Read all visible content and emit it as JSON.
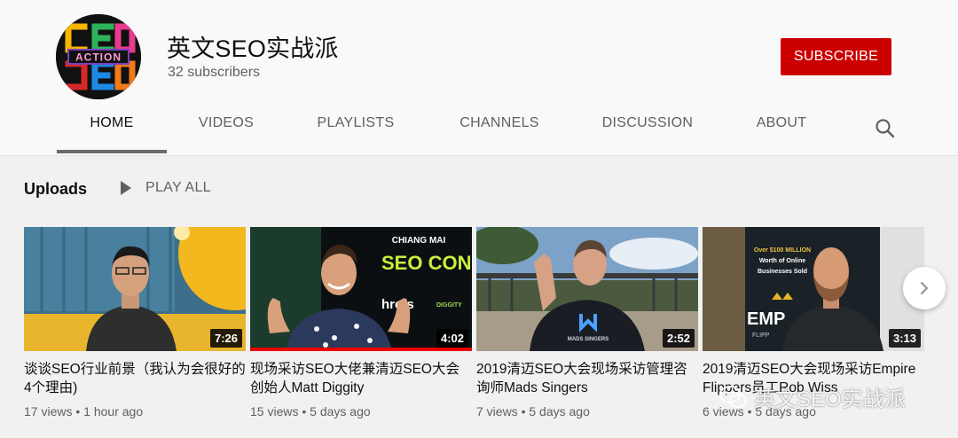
{
  "channel": {
    "name": "英文SEO实战派",
    "subscribers": "32 subscribers",
    "subscribe_label": "SUBSCRIBE",
    "avatar_text": "ACTION"
  },
  "tabs": [
    {
      "label": "HOME",
      "active": true
    },
    {
      "label": "VIDEOS"
    },
    {
      "label": "PLAYLISTS"
    },
    {
      "label": "CHANNELS"
    },
    {
      "label": "DISCUSSION"
    },
    {
      "label": "ABOUT"
    }
  ],
  "uploads": {
    "title": "Uploads",
    "play_all": "PLAY ALL"
  },
  "videos": [
    {
      "title": "谈谈SEO行业前景（我认为会很好的4个理由)",
      "duration": "7:26",
      "views": "17 views",
      "age": "1 hour ago"
    },
    {
      "title": "现场采访SEO大佬兼清迈SEO大会创始人Matt Diggity",
      "duration": "4:02",
      "views": "15 views",
      "age": "5 days ago",
      "thumb_text_1": "CHIANG MAI",
      "thumb_text_2": "SEO CONFERENC",
      "thumb_text_3": "hrefs",
      "thumb_text_4": "DIGGITY"
    },
    {
      "title": "2019清迈SEO大会现场采访管理咨询师Mads Singers",
      "duration": "2:52",
      "views": "7 views",
      "age": "5 days ago",
      "thumb_text_1": "MADS SINGERS"
    },
    {
      "title": "2019清迈SEO大会现场采访Empire Flippers员工Rob Wiss",
      "duration": "3:13",
      "views": "6 views",
      "age": "5 days ago",
      "thumb_text_1": "Over $100 MILLION",
      "thumb_text_2": "Worth of Online",
      "thumb_text_3": "Businesses Sold",
      "thumb_text_4": "EMP",
      "thumb_text_5": "FLIPP"
    }
  ],
  "watermark": {
    "text": "英文SEO实战派"
  },
  "colors": {
    "subscribe": "#cc0000",
    "progress": "#e00000"
  },
  "icons": [
    "search-icon",
    "play-icon",
    "chevron-right-icon",
    "wechat-icon"
  ]
}
